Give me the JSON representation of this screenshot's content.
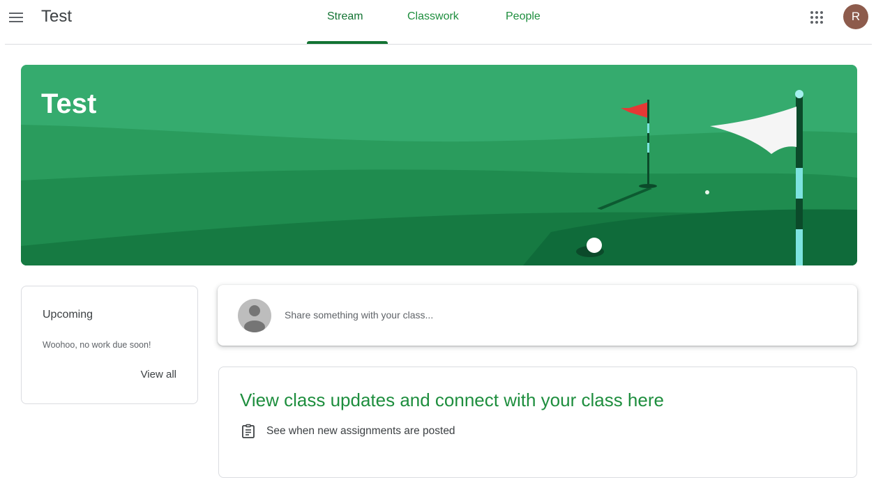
{
  "header": {
    "class_name": "Test",
    "tabs": [
      {
        "label": "Stream",
        "active": true
      },
      {
        "label": "Classwork",
        "active": false
      },
      {
        "label": "People",
        "active": false
      }
    ],
    "avatar_initial": "R",
    "icons": {
      "menu": "hamburger-menu-icon",
      "apps": "google-apps-grid-icon"
    }
  },
  "banner": {
    "title": "Test",
    "theme": "golf-course"
  },
  "upcoming": {
    "title": "Upcoming",
    "empty_message": "Woohoo, no work due soon!",
    "view_all_label": "View all"
  },
  "share": {
    "placeholder": "Share something with your class..."
  },
  "info": {
    "heading": "View class updates and connect with your class here",
    "items": [
      {
        "icon": "assignment-clipboard-icon",
        "text": "See when new assignments are posted"
      }
    ]
  },
  "colors": {
    "accent_green": "#1e8e3e",
    "tab_active": "#137333",
    "avatar_bg": "#8d5b4c",
    "banner_light": "#34a86b",
    "banner_dark": "#0f6b3a"
  }
}
